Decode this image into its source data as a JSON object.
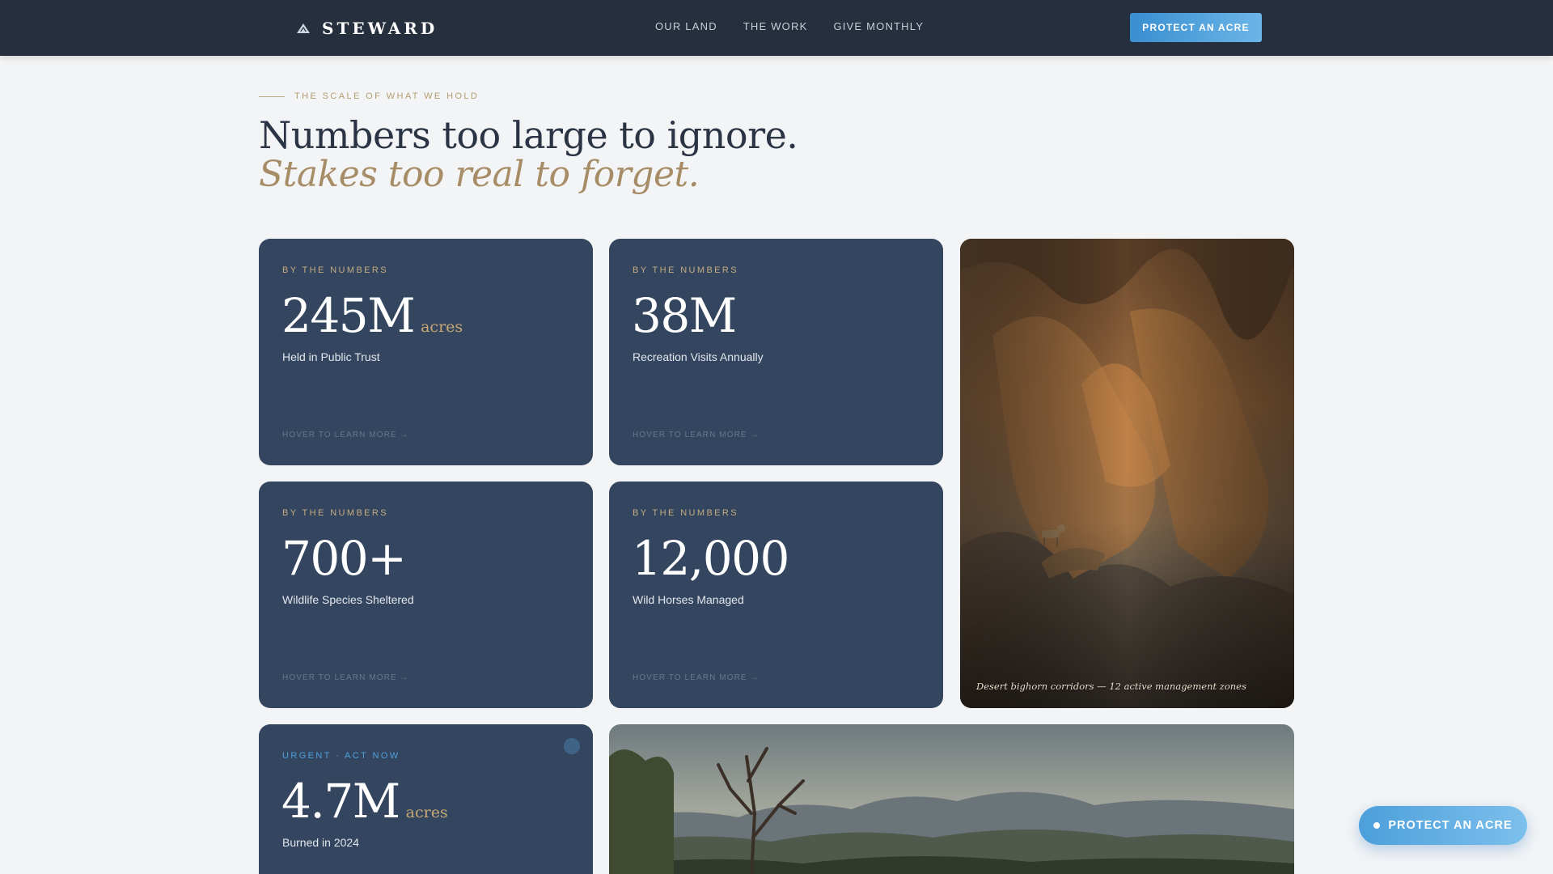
{
  "nav": {
    "brand": "STEWARD",
    "brand_icon": "mountain-icon",
    "links": [
      "OUR LAND",
      "THE WORK",
      "GIVE MONTHLY"
    ],
    "cta": "PROTECT AN ACRE"
  },
  "hero": {
    "eyebrow": "THE SCALE OF WHAT WE HOLD",
    "title": "Numbers too large to ignore.",
    "subtitle": "Stakes too real to forget."
  },
  "cards": [
    {
      "kicker": "BY THE NUMBERS",
      "value": "245M",
      "unit": "acres",
      "label": "Held in Public Trust",
      "hint": "HOVER TO LEARN MORE →"
    },
    {
      "kicker": "BY THE NUMBERS",
      "value": "38M",
      "unit": "",
      "label": "Recreation Visits Annually",
      "hint": "HOVER TO LEARN MORE →"
    },
    {
      "kicker": "BY THE NUMBERS",
      "value": "700+",
      "unit": "",
      "label": "Wildlife Species Sheltered",
      "hint": "HOVER TO LEARN MORE →"
    },
    {
      "kicker": "BY THE NUMBERS",
      "value": "12,000",
      "unit": "",
      "label": "Wild Horses Managed",
      "hint": "HOVER TO LEARN MORE →"
    },
    {
      "kicker": "URGENT · ACT NOW",
      "value": "4.7M",
      "unit": "acres",
      "label": "Burned in 2024"
    }
  ],
  "photos": {
    "canyon_caption": "Desert bighorn corridors — 12 active management zones"
  },
  "float_cta": "PROTECT AN ACRE",
  "colors": {
    "nav_bg": "#262f3d",
    "card_bg": "#34465f",
    "accent_blue": "#4c9fdb",
    "accent_gold": "#c9a874"
  }
}
